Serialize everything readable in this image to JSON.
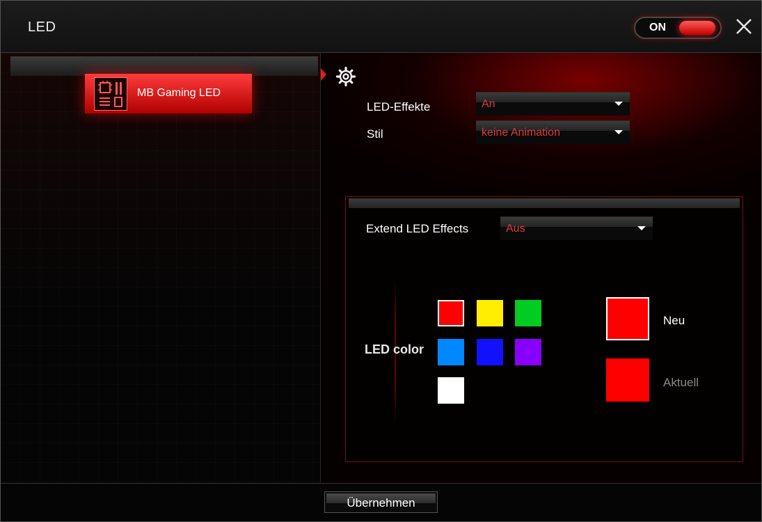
{
  "window": {
    "title": "LED",
    "power_toggle_label": "ON"
  },
  "device_list": {
    "items": [
      {
        "label": "MB Gaming LED",
        "icon": "motherboard-icon",
        "selected": true
      }
    ]
  },
  "settings": {
    "icon": "gear-icon",
    "led_effects": {
      "label": "LED-Effekte",
      "value": "An"
    },
    "style": {
      "label": "Stil",
      "value": "keine Animation"
    }
  },
  "extend": {
    "label": "Extend LED Effects",
    "value": "Aus"
  },
  "led_color": {
    "label": "LED color",
    "swatches": [
      {
        "color": "#ff0000",
        "selected": true
      },
      {
        "color": "#ffee00",
        "selected": false
      },
      {
        "color": "#00cc22",
        "selected": false
      },
      {
        "color": "#0088ff",
        "selected": false
      },
      {
        "color": "#1111ff",
        "selected": false
      },
      {
        "color": "#8800ff",
        "selected": false
      },
      {
        "color": "#ffffff",
        "selected": false
      }
    ],
    "new_label": "Neu",
    "new_color": "#ff0000",
    "current_label": "Aktuell",
    "current_color": "#ff0000"
  },
  "footer": {
    "apply_label": "Übernehmen"
  },
  "colors": {
    "accent": "#e31c1c",
    "dropdown_text": "#e03a3a"
  }
}
